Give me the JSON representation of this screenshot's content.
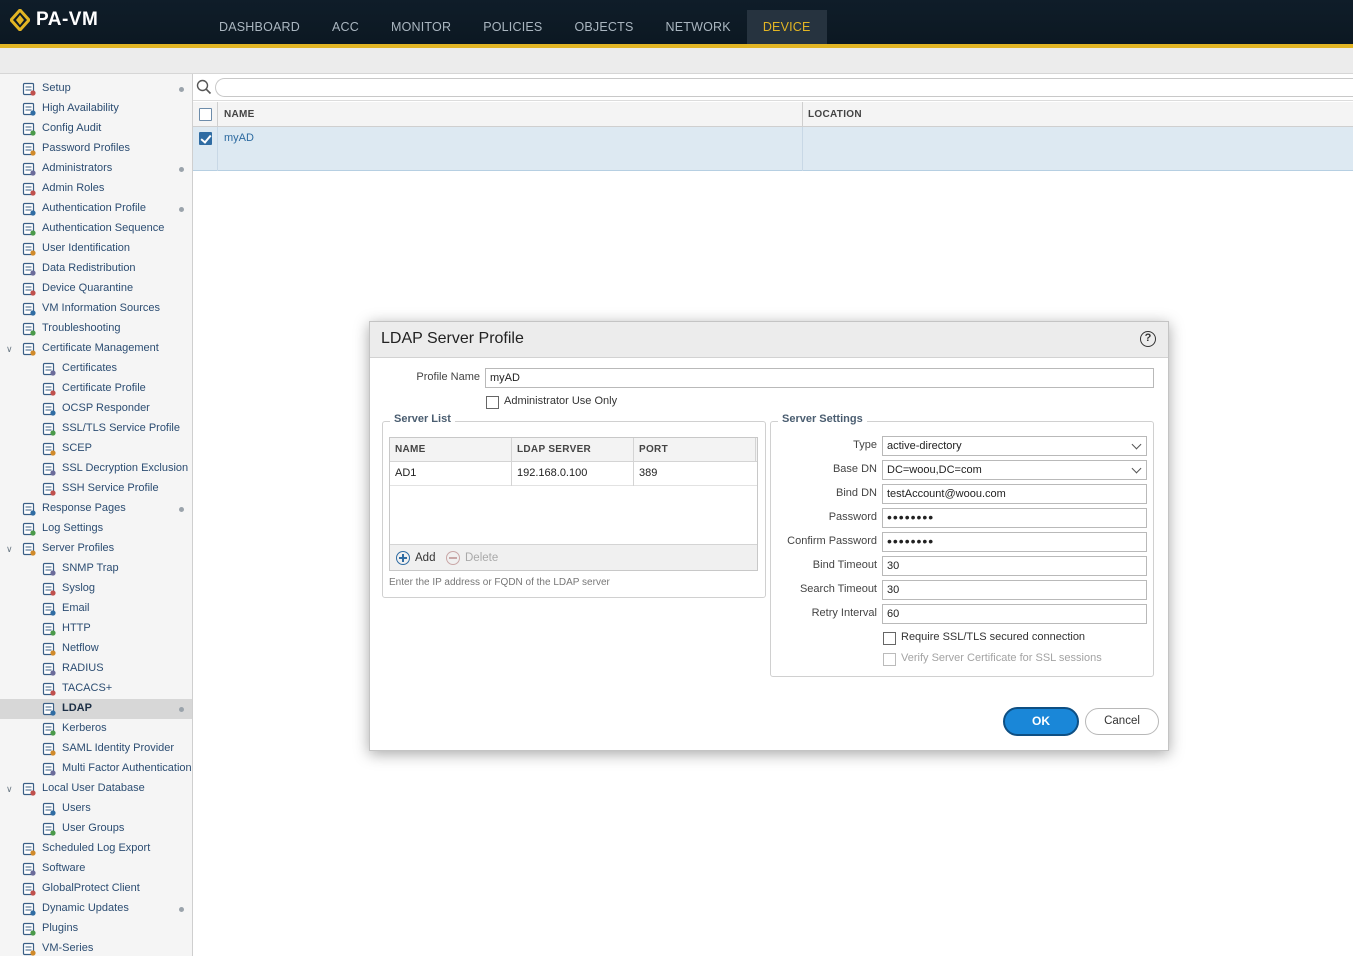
{
  "app": {
    "logo_text": "PA-VM",
    "nav_tabs": [
      {
        "label": "DASHBOARD"
      },
      {
        "label": "ACC"
      },
      {
        "label": "MONITOR"
      },
      {
        "label": "POLICIES"
      },
      {
        "label": "OBJECTS"
      },
      {
        "label": "NETWORK"
      },
      {
        "label": "DEVICE"
      }
    ],
    "active_tab": "DEVICE",
    "accent_color": "#e2b524"
  },
  "sidebar": {
    "items": [
      {
        "label": "Setup",
        "icon": "setup-icon",
        "level": 0,
        "dot": true
      },
      {
        "label": "High Availability",
        "icon": "ha-icon",
        "level": 0
      },
      {
        "label": "Config Audit",
        "icon": "audit-icon",
        "level": 0
      },
      {
        "label": "Password Profiles",
        "icon": "password-icon",
        "level": 0
      },
      {
        "label": "Administrators",
        "icon": "user-icon",
        "level": 0,
        "dot": true
      },
      {
        "label": "Admin Roles",
        "icon": "role-icon",
        "level": 0
      },
      {
        "label": "Authentication Profile",
        "icon": "auth-icon",
        "level": 0,
        "dot": true
      },
      {
        "label": "Authentication Sequence",
        "icon": "auth-seq-icon",
        "level": 0
      },
      {
        "label": "User Identification",
        "icon": "user-id-icon",
        "level": 0
      },
      {
        "label": "Data Redistribution",
        "icon": "redistribution-icon",
        "level": 0
      },
      {
        "label": "Device Quarantine",
        "icon": "quarantine-icon",
        "level": 0
      },
      {
        "label": "VM Information Sources",
        "icon": "vm-info-icon",
        "level": 0
      },
      {
        "label": "Troubleshooting",
        "icon": "tools-icon",
        "level": 0
      },
      {
        "label": "Certificate Management",
        "icon": "cert-mgmt-icon",
        "level": 0,
        "expanded": true
      },
      {
        "label": "Certificates",
        "icon": "certificate-icon",
        "level": 1
      },
      {
        "label": "Certificate Profile",
        "icon": "certificate-icon",
        "level": 1
      },
      {
        "label": "OCSP Responder",
        "icon": "certificate-icon",
        "level": 1
      },
      {
        "label": "SSL/TLS Service Profile",
        "icon": "lock-icon",
        "level": 1
      },
      {
        "label": "SCEP",
        "icon": "scep-icon",
        "level": 1
      },
      {
        "label": "SSL Decryption Exclusion",
        "icon": "lock-icon",
        "level": 1
      },
      {
        "label": "SSH Service Profile",
        "icon": "certificate-icon",
        "level": 1
      },
      {
        "label": "Response Pages",
        "icon": "response-pages-icon",
        "level": 0,
        "dot": true
      },
      {
        "label": "Log Settings",
        "icon": "log-icon",
        "level": 0
      },
      {
        "label": "Server Profiles",
        "icon": "server-profiles-icon",
        "level": 0,
        "expanded": true
      },
      {
        "label": "SNMP Trap",
        "icon": "doc-icon",
        "level": 1
      },
      {
        "label": "Syslog",
        "icon": "doc-icon",
        "level": 1
      },
      {
        "label": "Email",
        "icon": "doc-icon",
        "level": 1
      },
      {
        "label": "HTTP",
        "icon": "doc-icon",
        "level": 1
      },
      {
        "label": "Netflow",
        "icon": "doc-icon",
        "level": 1
      },
      {
        "label": "RADIUS",
        "icon": "doc-lock-icon",
        "level": 1
      },
      {
        "label": "TACACS+",
        "icon": "doc-lock-icon",
        "level": 1
      },
      {
        "label": "LDAP",
        "icon": "doc-lock-icon",
        "level": 1,
        "selected": true,
        "dot": true
      },
      {
        "label": "Kerberos",
        "icon": "doc-lock-icon",
        "level": 1
      },
      {
        "label": "SAML Identity Provider",
        "icon": "doc-lock-icon",
        "level": 1
      },
      {
        "label": "Multi Factor Authentication",
        "icon": "doc-lock-icon",
        "level": 1
      },
      {
        "label": "Local User Database",
        "icon": "database-icon",
        "level": 0,
        "expanded": true
      },
      {
        "label": "Users",
        "icon": "user-icon",
        "level": 1
      },
      {
        "label": "User Groups",
        "icon": "user-group-icon",
        "level": 1
      },
      {
        "label": "Scheduled Log Export",
        "icon": "log-export-icon",
        "level": 0
      },
      {
        "label": "Software",
        "icon": "software-icon",
        "level": 0
      },
      {
        "label": "GlobalProtect Client",
        "icon": "globe-icon",
        "level": 0
      },
      {
        "label": "Dynamic Updates",
        "icon": "updates-icon",
        "level": 0,
        "dot": true
      },
      {
        "label": "Plugins",
        "icon": "plugin-icon",
        "level": 0
      },
      {
        "label": "VM-Series",
        "icon": "vm-series-icon",
        "level": 0
      }
    ]
  },
  "grid": {
    "search_placeholder": "",
    "columns": [
      "NAME",
      "LOCATION"
    ],
    "rows": [
      {
        "name": "myAD",
        "location": "",
        "checked": true
      }
    ]
  },
  "dialog": {
    "title": "LDAP Server Profile",
    "help": "?",
    "profile_name_label": "Profile Name",
    "profile_name_value": "myAD",
    "admin_use_only_label": "Administrator Use Only",
    "server_list": {
      "legend": "Server List",
      "columns": [
        "NAME",
        "LDAP SERVER",
        "PORT"
      ],
      "rows": [
        {
          "name": "AD1",
          "server": "192.168.0.100",
          "port": "389"
        }
      ],
      "add_label": "Add",
      "delete_label": "Delete",
      "hint": "Enter the IP address or FQDN of the LDAP server"
    },
    "server_settings": {
      "legend": "Server Settings",
      "type_label": "Type",
      "type_value": "active-directory",
      "base_dn_label": "Base DN",
      "base_dn_value": "DC=woou,DC=com",
      "bind_dn_label": "Bind DN",
      "bind_dn_value": "testAccount@woou.com",
      "password_label": "Password",
      "password_value": "••••••••",
      "confirm_password_label": "Confirm Password",
      "confirm_password_value": "••••••••",
      "bind_timeout_label": "Bind Timeout",
      "bind_timeout_value": "30",
      "search_timeout_label": "Search Timeout",
      "search_timeout_value": "30",
      "retry_interval_label": "Retry Interval",
      "retry_interval_value": "60",
      "require_ssl_label": "Require SSL/TLS secured connection",
      "verify_cert_label": "Verify Server Certificate for SSL sessions"
    },
    "ok_label": "OK",
    "cancel_label": "Cancel"
  }
}
